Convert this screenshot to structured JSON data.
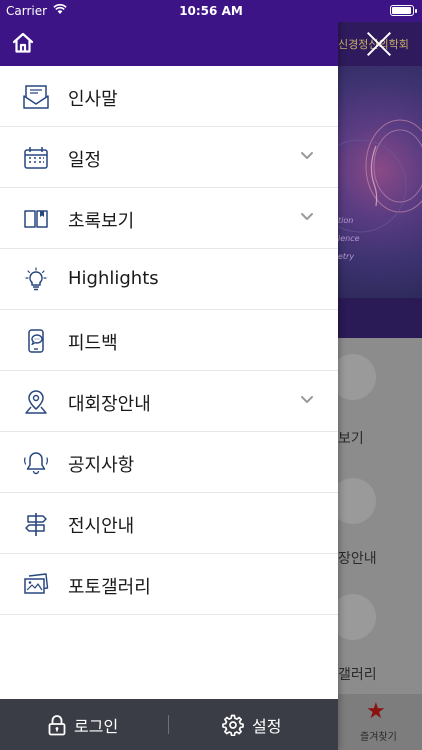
{
  "status_bar": {
    "carrier": "Carrier",
    "time": "10:56 AM"
  },
  "background_app": {
    "header_title": "신경정신의학회",
    "banner_lines": [
      "tion",
      "ience",
      "etry"
    ],
    "labels": [
      "보기",
      "장안내",
      "갤러리"
    ],
    "tab_label": "즐겨찾기",
    "star_icon": "star-icon"
  },
  "drawer": {
    "home_icon": "home-icon",
    "close_icon": "close-icon",
    "menu": [
      {
        "label": "인사말",
        "icon": "envelope-icon",
        "has_submenu": false
      },
      {
        "label": "일정",
        "icon": "calendar-icon",
        "has_submenu": true
      },
      {
        "label": "초록보기",
        "icon": "book-icon",
        "has_submenu": true
      },
      {
        "label": "Highlights",
        "icon": "lightbulb-icon",
        "has_submenu": false
      },
      {
        "label": "피드백",
        "icon": "feedback-icon",
        "has_submenu": false
      },
      {
        "label": "대회장안내",
        "icon": "map-pin-icon",
        "has_submenu": true
      },
      {
        "label": "공지사항",
        "icon": "bell-icon",
        "has_submenu": false
      },
      {
        "label": "전시안내",
        "icon": "signpost-icon",
        "has_submenu": false
      },
      {
        "label": "포토갤러리",
        "icon": "photos-icon",
        "has_submenu": false
      }
    ],
    "bottom": {
      "login_label": "로그인",
      "settings_label": "설정"
    }
  },
  "colors": {
    "header": "#3c1486",
    "icon_blue": "#27477f",
    "bottom_bar": "#3a3d45",
    "chevron": "#9a9a9a"
  }
}
